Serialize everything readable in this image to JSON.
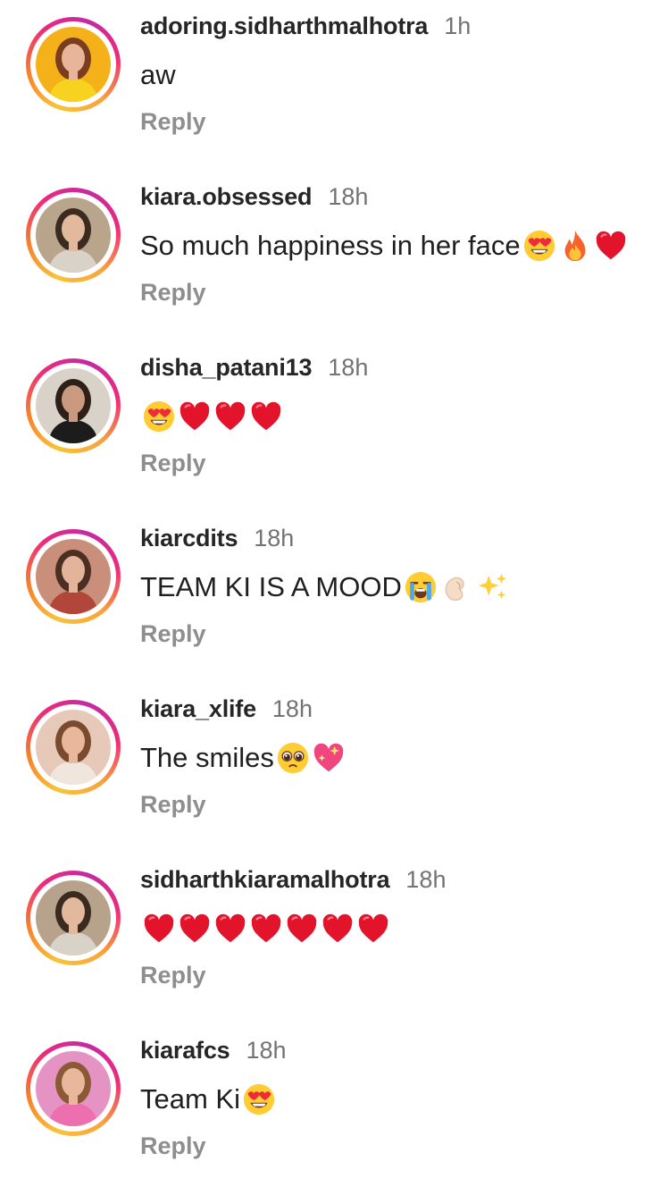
{
  "comments": [
    {
      "username": "adoring.sidharthmalhotra",
      "time": "1h",
      "text": "aw",
      "emojis": [],
      "reply": "Reply",
      "avatar": {
        "bg": "#f5b11a",
        "skin": "#e9b59a",
        "hair": "#7a3e1f",
        "top": "#f7d21e"
      }
    },
    {
      "username": "kiara.obsessed",
      "time": "18h",
      "text": "So much happiness in her face",
      "emojis": [
        "heart-eyes",
        "fire",
        "red-heart"
      ],
      "reply": "Reply",
      "avatar": {
        "bg": "#b9a48c",
        "skin": "#e2b99c",
        "hair": "#3b2a20",
        "top": "#d8d2c8"
      }
    },
    {
      "username": "disha_patani13",
      "time": "18h",
      "text": "",
      "emojis": [
        "heart-eyes",
        "red-heart",
        "red-heart",
        "red-heart"
      ],
      "reply": "Reply",
      "avatar": {
        "bg": "#d9d2c8",
        "skin": "#c99a80",
        "hair": "#2e2019",
        "top": "#1c1c1c"
      }
    },
    {
      "username": "kiarcdits",
      "time": "18h",
      "text": "TEAM KI IS A MOOD ",
      "emojis": [
        "crying",
        "pinch",
        "sparkles"
      ],
      "reply": "Reply",
      "avatar": {
        "bg": "#c98f7b",
        "skin": "#e3b49a",
        "hair": "#4a2f22",
        "top": "#b2463a"
      }
    },
    {
      "username": "kiara_xlife",
      "time": "18h",
      "text": "The smiles ",
      "emojis": [
        "pleading",
        "sparkling-heart"
      ],
      "reply": "Reply",
      "avatar": {
        "bg": "#e6c9b8",
        "skin": "#e8b79c",
        "hair": "#7a4a2e",
        "top": "#f0e6de"
      }
    },
    {
      "username": "sidharthkiaramalhotra",
      "time": "18h",
      "text": "",
      "emojis": [
        "red-heart",
        "red-heart",
        "red-heart",
        "red-heart",
        "red-heart",
        "red-heart",
        "red-heart"
      ],
      "reply": "Reply",
      "avatar": {
        "bg": "#b7a38c",
        "skin": "#e2b99c",
        "hair": "#3b2a20",
        "top": "#d8d2c8"
      }
    },
    {
      "username": "kiarafcs",
      "time": "18h",
      "text": "Team Ki",
      "emojis": [
        "heart-eyes"
      ],
      "reply": "Reply",
      "avatar": {
        "bg": "#e493c2",
        "skin": "#e8b79c",
        "hair": "#8a5a34",
        "top": "#ee6fb0"
      }
    }
  ]
}
